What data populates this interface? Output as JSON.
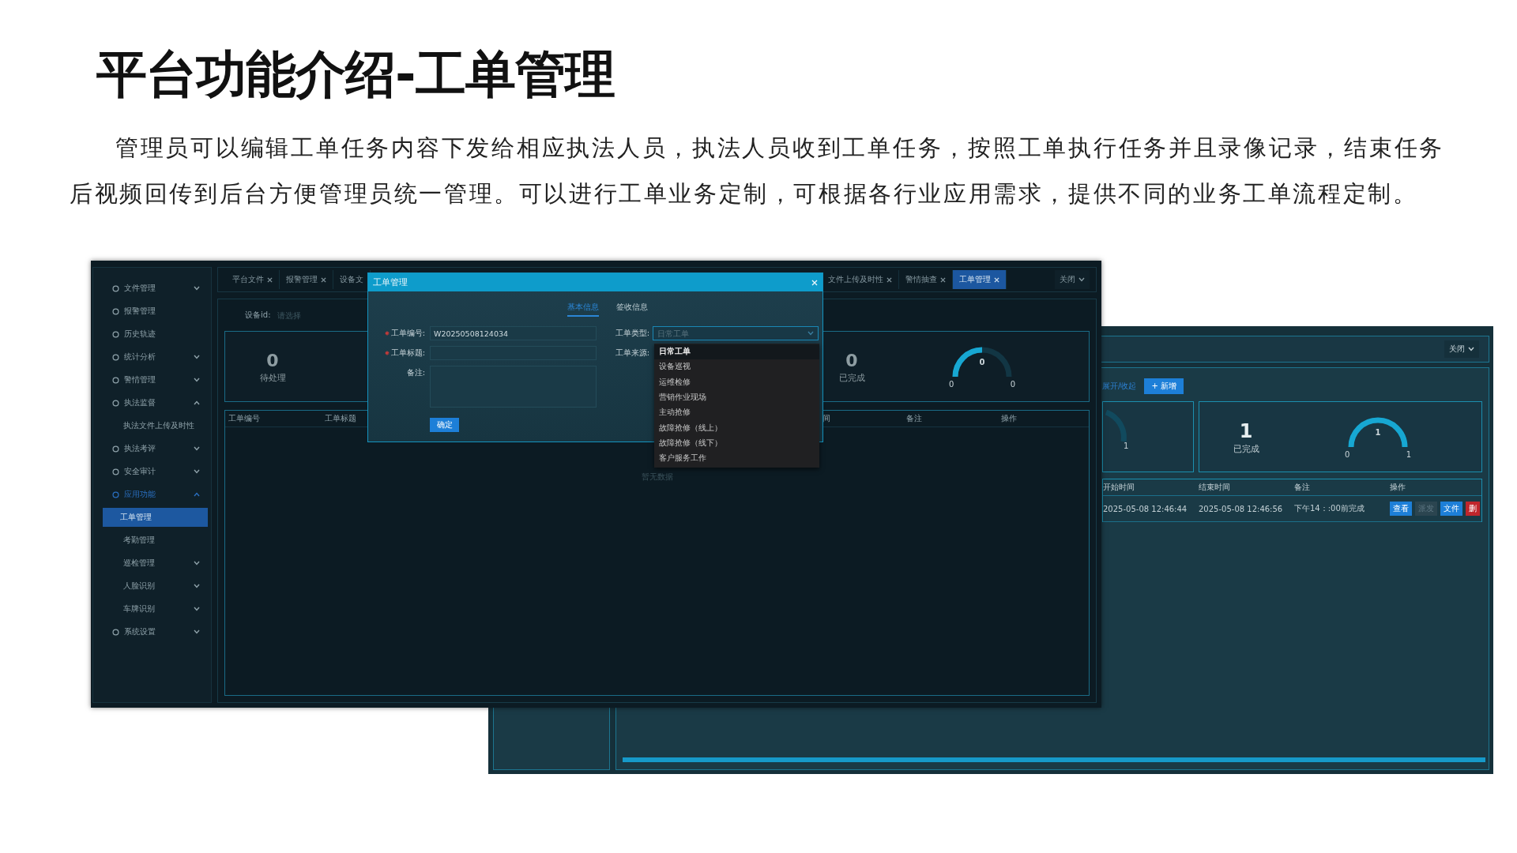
{
  "slide": {
    "title": "平台功能介绍-工单管理",
    "description": "管理员可以编辑工单任务内容下发给相应执法人员，执法人员收到工单任务，按照工单执行任务并且录像记录，结束任务后视频回传到后台方便管理员统一管理。可以进行工单业务定制，可根据各行业应用需求，提供不同的业务工单流程定制。"
  },
  "main_window": {
    "sidebar": {
      "items": [
        {
          "label": "文件管理",
          "kind": "group",
          "expanded": false,
          "selected": false
        },
        {
          "label": "报警管理",
          "kind": "link",
          "selected": false
        },
        {
          "label": "历史轨迹",
          "kind": "link",
          "selected": false
        },
        {
          "label": "统计分析",
          "kind": "group",
          "expanded": false,
          "selected": false
        },
        {
          "label": "警情管理",
          "kind": "group",
          "expanded": false,
          "selected": false
        },
        {
          "label": "执法监督",
          "kind": "group",
          "expanded": true,
          "selected": false,
          "children": [
            {
              "label": "执法文件上传及时性",
              "kind": "link",
              "selected": false
            }
          ]
        },
        {
          "label": "执法考评",
          "kind": "group",
          "expanded": false,
          "selected": false
        },
        {
          "label": "安全审计",
          "kind": "group",
          "expanded": false,
          "selected": false
        },
        {
          "label": "应用功能",
          "kind": "group",
          "expanded": true,
          "selected": true,
          "children": [
            {
              "label": "工单管理",
              "kind": "link",
              "selected": true
            },
            {
              "label": "考勤管理",
              "kind": "link",
              "selected": false
            },
            {
              "label": "巡检管理",
              "kind": "group",
              "expanded": false,
              "selected": false
            },
            {
              "label": "人脸识别",
              "kind": "group",
              "expanded": false,
              "selected": false
            },
            {
              "label": "车牌识别",
              "kind": "group",
              "expanded": false,
              "selected": false
            }
          ]
        },
        {
          "label": "系统设置",
          "kind": "group",
          "expanded": false,
          "selected": false
        }
      ]
    },
    "tabs": [
      {
        "label": "平台文件",
        "selected": false,
        "closable": true
      },
      {
        "label": "报警管理",
        "selected": false,
        "closable": true
      },
      {
        "label": "设备文",
        "selected": false,
        "closable": false
      },
      {
        "label": "文件上传及时性",
        "selected": false,
        "closable": true
      },
      {
        "label": "警情抽查",
        "selected": false,
        "closable": true
      },
      {
        "label": "工单管理",
        "selected": true,
        "closable": true
      }
    ],
    "close_menu": "关闭",
    "filter": {
      "label": "设备id:",
      "placeholder": "请选择"
    },
    "stats": [
      {
        "value": "0",
        "label": "待处理"
      },
      {
        "value": "0",
        "label": "已完成"
      }
    ],
    "gauge": {
      "value": "0",
      "min": "0",
      "max": "0",
      "level": 0.5
    },
    "table": {
      "columns": [
        "工单编号",
        "工单标题",
        "间",
        "备注",
        "操作"
      ],
      "empty_text": "暂无数据"
    }
  },
  "dialog": {
    "title": "工单管理",
    "tabs": [
      {
        "label": "基本信息",
        "selected": true
      },
      {
        "label": "签收信息",
        "selected": false
      }
    ],
    "fields": [
      {
        "label": "工单编号:",
        "required": true,
        "kind": "input",
        "value": "W20250508124034"
      },
      {
        "label": "工单标题:",
        "required": true,
        "kind": "input"
      },
      {
        "label": "备注:",
        "required": false,
        "kind": "textarea"
      }
    ],
    "type_field": {
      "label": "工单类型:",
      "placeholder": "日常工单"
    },
    "source_field": {
      "label": "工单来源:"
    },
    "submit": "确定",
    "dropdown": [
      {
        "label": "日常工单",
        "selected": true
      },
      {
        "label": "设备巡视",
        "selected": false
      },
      {
        "label": "运维检修",
        "selected": false
      },
      {
        "label": "营销作业现场",
        "selected": false
      },
      {
        "label": "主动抢修",
        "selected": false
      },
      {
        "label": "故障抢修（线上）",
        "selected": false
      },
      {
        "label": "故障抢修（线下）",
        "selected": false
      },
      {
        "label": "客户服务工作",
        "selected": false
      }
    ]
  },
  "back_window": {
    "close_menu": "关闭",
    "toggle_link": "展开/收起",
    "add_button": "+ 新增",
    "partial_gauge": {
      "max": "1"
    },
    "completed": {
      "value": "1",
      "label": "已完成"
    },
    "gauge": {
      "value": "1",
      "min": "0",
      "max": "1",
      "level": 1
    },
    "table": {
      "columns": [
        "开始时间",
        "结束时间",
        "备注",
        "操作"
      ],
      "rows": [
        {
          "cells": [
            "2025-05-08 12:46:44",
            "2025-05-08 12:46:56",
            "下午14：:00前完成"
          ],
          "actions": [
            {
              "label": "查看",
              "kind": "primary"
            },
            {
              "label": "派发",
              "kind": "disabled"
            },
            {
              "label": "文件",
              "kind": "primary"
            },
            {
              "label": "删",
              "kind": "danger"
            }
          ]
        }
      ]
    }
  }
}
